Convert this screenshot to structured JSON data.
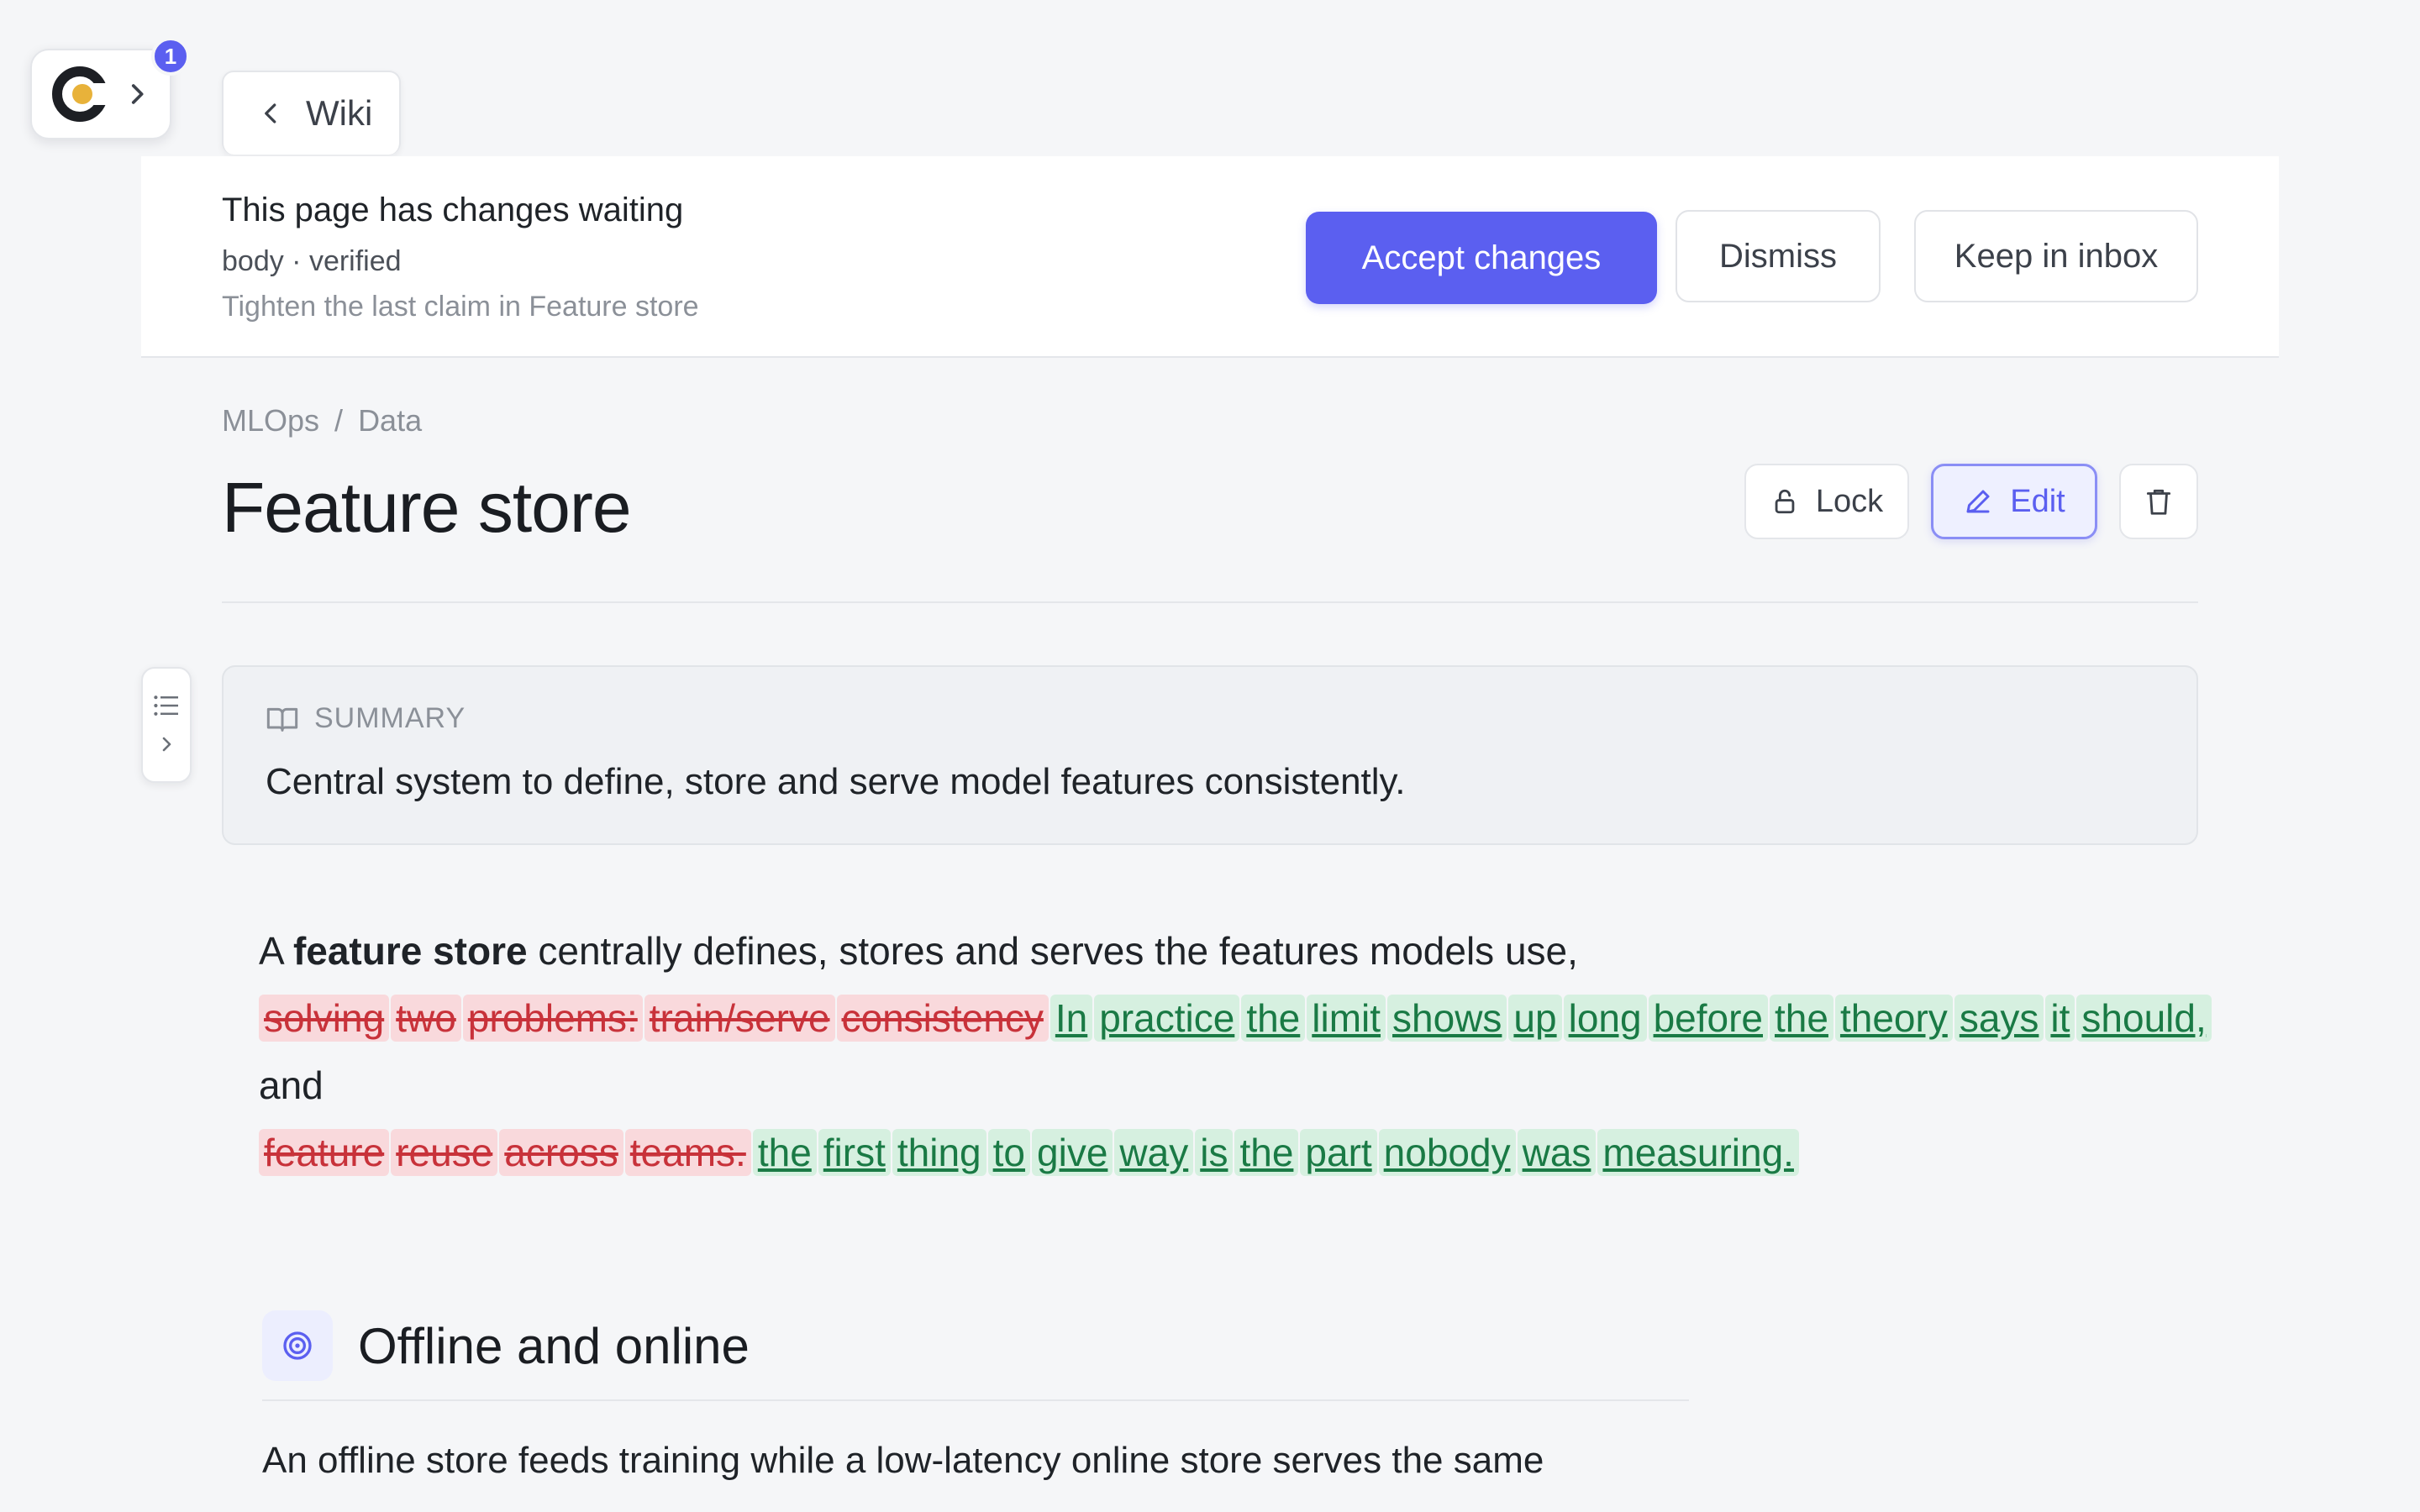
{
  "app": {
    "notification_count": "1",
    "back_label": "Wiki"
  },
  "review": {
    "title": "This page has changes waiting",
    "meta": "body · verified",
    "description": "Tighten the last claim in Feature store",
    "accept_label": "Accept changes",
    "dismiss_label": "Dismiss",
    "keep_label": "Keep in inbox"
  },
  "breadcrumb": [
    "MLOps",
    "/",
    "Data"
  ],
  "page": {
    "title": "Feature store",
    "lock_label": "Lock",
    "edit_label": "Edit"
  },
  "summary": {
    "label": "SUMMARY",
    "text": "Central system to define, store and serve model features consistently."
  },
  "body": {
    "lead": "A ",
    "bold": "feature store",
    "after_bold": " centrally defines, stores and serves the features models use, ",
    "deleted_1": [
      "solving",
      "two",
      "problems:",
      "train/serve",
      "consistency"
    ],
    "inserted_1": [
      "In",
      "practice",
      "the",
      "limit",
      "shows",
      "up",
      "long",
      "before",
      "the",
      "theory",
      "says",
      "it",
      "should,"
    ],
    "middle": " and ",
    "deleted_2": [
      "feature",
      "reuse",
      "across",
      "teams."
    ],
    "inserted_2": [
      "the",
      "first",
      "thing",
      "to",
      "give",
      "way",
      "is",
      "the",
      "part",
      "nobody",
      "was",
      "measuring."
    ]
  },
  "section": {
    "title": "Offline and online",
    "text": "An offline store feeds training while a low-latency online store serves the same"
  },
  "colors": {
    "accent": "#5b5ff0",
    "deleted_bg": "#f9d9dc",
    "deleted_text": "#c8323a",
    "inserted_bg": "#d6f0e0",
    "inserted_text": "#1a7a45"
  }
}
